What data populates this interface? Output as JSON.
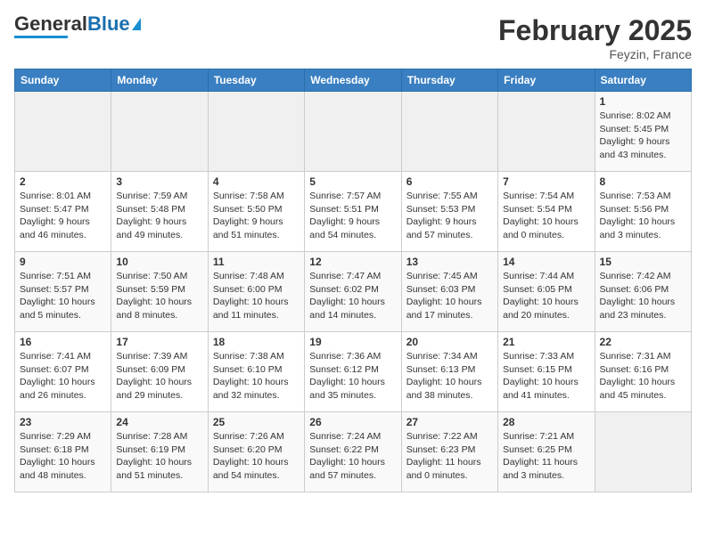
{
  "header": {
    "logo_general": "General",
    "logo_blue": "Blue",
    "month_title": "February 2025",
    "location": "Feyzin, France"
  },
  "calendar": {
    "days_of_week": [
      "Sunday",
      "Monday",
      "Tuesday",
      "Wednesday",
      "Thursday",
      "Friday",
      "Saturday"
    ],
    "weeks": [
      [
        {
          "day": "",
          "info": ""
        },
        {
          "day": "",
          "info": ""
        },
        {
          "day": "",
          "info": ""
        },
        {
          "day": "",
          "info": ""
        },
        {
          "day": "",
          "info": ""
        },
        {
          "day": "",
          "info": ""
        },
        {
          "day": "1",
          "info": "Sunrise: 8:02 AM\nSunset: 5:45 PM\nDaylight: 9 hours and 43 minutes."
        }
      ],
      [
        {
          "day": "2",
          "info": "Sunrise: 8:01 AM\nSunset: 5:47 PM\nDaylight: 9 hours and 46 minutes."
        },
        {
          "day": "3",
          "info": "Sunrise: 7:59 AM\nSunset: 5:48 PM\nDaylight: 9 hours and 49 minutes."
        },
        {
          "day": "4",
          "info": "Sunrise: 7:58 AM\nSunset: 5:50 PM\nDaylight: 9 hours and 51 minutes."
        },
        {
          "day": "5",
          "info": "Sunrise: 7:57 AM\nSunset: 5:51 PM\nDaylight: 9 hours and 54 minutes."
        },
        {
          "day": "6",
          "info": "Sunrise: 7:55 AM\nSunset: 5:53 PM\nDaylight: 9 hours and 57 minutes."
        },
        {
          "day": "7",
          "info": "Sunrise: 7:54 AM\nSunset: 5:54 PM\nDaylight: 10 hours and 0 minutes."
        },
        {
          "day": "8",
          "info": "Sunrise: 7:53 AM\nSunset: 5:56 PM\nDaylight: 10 hours and 3 minutes."
        }
      ],
      [
        {
          "day": "9",
          "info": "Sunrise: 7:51 AM\nSunset: 5:57 PM\nDaylight: 10 hours and 5 minutes."
        },
        {
          "day": "10",
          "info": "Sunrise: 7:50 AM\nSunset: 5:59 PM\nDaylight: 10 hours and 8 minutes."
        },
        {
          "day": "11",
          "info": "Sunrise: 7:48 AM\nSunset: 6:00 PM\nDaylight: 10 hours and 11 minutes."
        },
        {
          "day": "12",
          "info": "Sunrise: 7:47 AM\nSunset: 6:02 PM\nDaylight: 10 hours and 14 minutes."
        },
        {
          "day": "13",
          "info": "Sunrise: 7:45 AM\nSunset: 6:03 PM\nDaylight: 10 hours and 17 minutes."
        },
        {
          "day": "14",
          "info": "Sunrise: 7:44 AM\nSunset: 6:05 PM\nDaylight: 10 hours and 20 minutes."
        },
        {
          "day": "15",
          "info": "Sunrise: 7:42 AM\nSunset: 6:06 PM\nDaylight: 10 hours and 23 minutes."
        }
      ],
      [
        {
          "day": "16",
          "info": "Sunrise: 7:41 AM\nSunset: 6:07 PM\nDaylight: 10 hours and 26 minutes."
        },
        {
          "day": "17",
          "info": "Sunrise: 7:39 AM\nSunset: 6:09 PM\nDaylight: 10 hours and 29 minutes."
        },
        {
          "day": "18",
          "info": "Sunrise: 7:38 AM\nSunset: 6:10 PM\nDaylight: 10 hours and 32 minutes."
        },
        {
          "day": "19",
          "info": "Sunrise: 7:36 AM\nSunset: 6:12 PM\nDaylight: 10 hours and 35 minutes."
        },
        {
          "day": "20",
          "info": "Sunrise: 7:34 AM\nSunset: 6:13 PM\nDaylight: 10 hours and 38 minutes."
        },
        {
          "day": "21",
          "info": "Sunrise: 7:33 AM\nSunset: 6:15 PM\nDaylight: 10 hours and 41 minutes."
        },
        {
          "day": "22",
          "info": "Sunrise: 7:31 AM\nSunset: 6:16 PM\nDaylight: 10 hours and 45 minutes."
        }
      ],
      [
        {
          "day": "23",
          "info": "Sunrise: 7:29 AM\nSunset: 6:18 PM\nDaylight: 10 hours and 48 minutes."
        },
        {
          "day": "24",
          "info": "Sunrise: 7:28 AM\nSunset: 6:19 PM\nDaylight: 10 hours and 51 minutes."
        },
        {
          "day": "25",
          "info": "Sunrise: 7:26 AM\nSunset: 6:20 PM\nDaylight: 10 hours and 54 minutes."
        },
        {
          "day": "26",
          "info": "Sunrise: 7:24 AM\nSunset: 6:22 PM\nDaylight: 10 hours and 57 minutes."
        },
        {
          "day": "27",
          "info": "Sunrise: 7:22 AM\nSunset: 6:23 PM\nDaylight: 11 hours and 0 minutes."
        },
        {
          "day": "28",
          "info": "Sunrise: 7:21 AM\nSunset: 6:25 PM\nDaylight: 11 hours and 3 minutes."
        },
        {
          "day": "",
          "info": ""
        }
      ]
    ]
  }
}
